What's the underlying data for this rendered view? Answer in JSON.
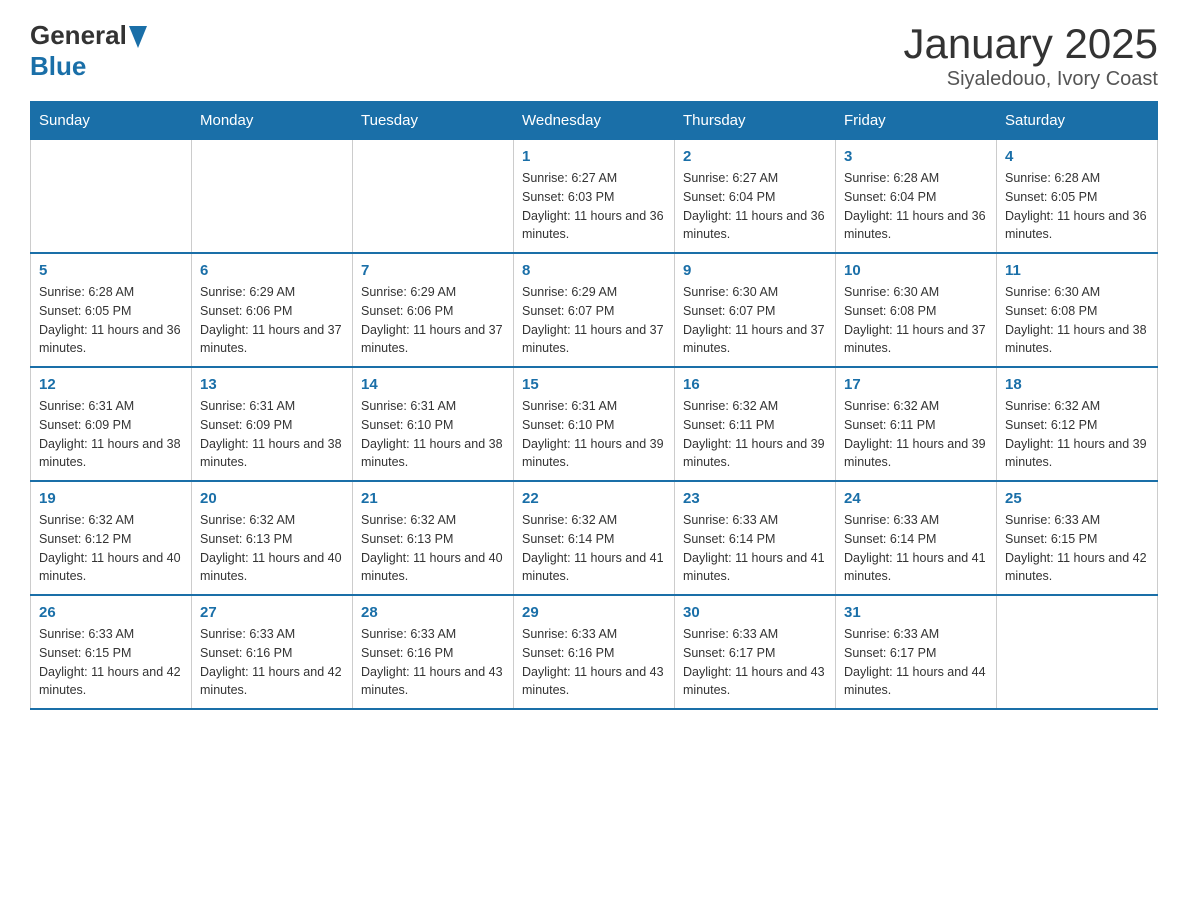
{
  "logo": {
    "general": "General",
    "blue": "Blue"
  },
  "title": "January 2025",
  "subtitle": "Siyaledouo, Ivory Coast",
  "days_of_week": [
    "Sunday",
    "Monday",
    "Tuesday",
    "Wednesday",
    "Thursday",
    "Friday",
    "Saturday"
  ],
  "weeks": [
    [
      {
        "day": "",
        "info": ""
      },
      {
        "day": "",
        "info": ""
      },
      {
        "day": "",
        "info": ""
      },
      {
        "day": "1",
        "info": "Sunrise: 6:27 AM\nSunset: 6:03 PM\nDaylight: 11 hours and 36 minutes."
      },
      {
        "day": "2",
        "info": "Sunrise: 6:27 AM\nSunset: 6:04 PM\nDaylight: 11 hours and 36 minutes."
      },
      {
        "day": "3",
        "info": "Sunrise: 6:28 AM\nSunset: 6:04 PM\nDaylight: 11 hours and 36 minutes."
      },
      {
        "day": "4",
        "info": "Sunrise: 6:28 AM\nSunset: 6:05 PM\nDaylight: 11 hours and 36 minutes."
      }
    ],
    [
      {
        "day": "5",
        "info": "Sunrise: 6:28 AM\nSunset: 6:05 PM\nDaylight: 11 hours and 36 minutes."
      },
      {
        "day": "6",
        "info": "Sunrise: 6:29 AM\nSunset: 6:06 PM\nDaylight: 11 hours and 37 minutes."
      },
      {
        "day": "7",
        "info": "Sunrise: 6:29 AM\nSunset: 6:06 PM\nDaylight: 11 hours and 37 minutes."
      },
      {
        "day": "8",
        "info": "Sunrise: 6:29 AM\nSunset: 6:07 PM\nDaylight: 11 hours and 37 minutes."
      },
      {
        "day": "9",
        "info": "Sunrise: 6:30 AM\nSunset: 6:07 PM\nDaylight: 11 hours and 37 minutes."
      },
      {
        "day": "10",
        "info": "Sunrise: 6:30 AM\nSunset: 6:08 PM\nDaylight: 11 hours and 37 minutes."
      },
      {
        "day": "11",
        "info": "Sunrise: 6:30 AM\nSunset: 6:08 PM\nDaylight: 11 hours and 38 minutes."
      }
    ],
    [
      {
        "day": "12",
        "info": "Sunrise: 6:31 AM\nSunset: 6:09 PM\nDaylight: 11 hours and 38 minutes."
      },
      {
        "day": "13",
        "info": "Sunrise: 6:31 AM\nSunset: 6:09 PM\nDaylight: 11 hours and 38 minutes."
      },
      {
        "day": "14",
        "info": "Sunrise: 6:31 AM\nSunset: 6:10 PM\nDaylight: 11 hours and 38 minutes."
      },
      {
        "day": "15",
        "info": "Sunrise: 6:31 AM\nSunset: 6:10 PM\nDaylight: 11 hours and 39 minutes."
      },
      {
        "day": "16",
        "info": "Sunrise: 6:32 AM\nSunset: 6:11 PM\nDaylight: 11 hours and 39 minutes."
      },
      {
        "day": "17",
        "info": "Sunrise: 6:32 AM\nSunset: 6:11 PM\nDaylight: 11 hours and 39 minutes."
      },
      {
        "day": "18",
        "info": "Sunrise: 6:32 AM\nSunset: 6:12 PM\nDaylight: 11 hours and 39 minutes."
      }
    ],
    [
      {
        "day": "19",
        "info": "Sunrise: 6:32 AM\nSunset: 6:12 PM\nDaylight: 11 hours and 40 minutes."
      },
      {
        "day": "20",
        "info": "Sunrise: 6:32 AM\nSunset: 6:13 PM\nDaylight: 11 hours and 40 minutes."
      },
      {
        "day": "21",
        "info": "Sunrise: 6:32 AM\nSunset: 6:13 PM\nDaylight: 11 hours and 40 minutes."
      },
      {
        "day": "22",
        "info": "Sunrise: 6:32 AM\nSunset: 6:14 PM\nDaylight: 11 hours and 41 minutes."
      },
      {
        "day": "23",
        "info": "Sunrise: 6:33 AM\nSunset: 6:14 PM\nDaylight: 11 hours and 41 minutes."
      },
      {
        "day": "24",
        "info": "Sunrise: 6:33 AM\nSunset: 6:14 PM\nDaylight: 11 hours and 41 minutes."
      },
      {
        "day": "25",
        "info": "Sunrise: 6:33 AM\nSunset: 6:15 PM\nDaylight: 11 hours and 42 minutes."
      }
    ],
    [
      {
        "day": "26",
        "info": "Sunrise: 6:33 AM\nSunset: 6:15 PM\nDaylight: 11 hours and 42 minutes."
      },
      {
        "day": "27",
        "info": "Sunrise: 6:33 AM\nSunset: 6:16 PM\nDaylight: 11 hours and 42 minutes."
      },
      {
        "day": "28",
        "info": "Sunrise: 6:33 AM\nSunset: 6:16 PM\nDaylight: 11 hours and 43 minutes."
      },
      {
        "day": "29",
        "info": "Sunrise: 6:33 AM\nSunset: 6:16 PM\nDaylight: 11 hours and 43 minutes."
      },
      {
        "day": "30",
        "info": "Sunrise: 6:33 AM\nSunset: 6:17 PM\nDaylight: 11 hours and 43 minutes."
      },
      {
        "day": "31",
        "info": "Sunrise: 6:33 AM\nSunset: 6:17 PM\nDaylight: 11 hours and 44 minutes."
      },
      {
        "day": "",
        "info": ""
      }
    ]
  ]
}
